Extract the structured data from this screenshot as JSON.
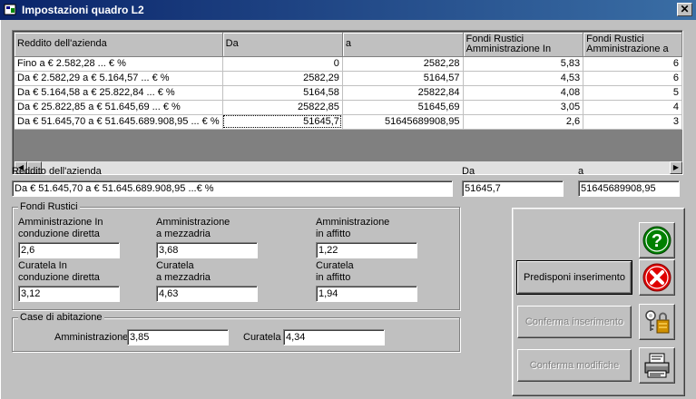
{
  "window": {
    "title": "Impostazioni quadro L2",
    "close_glyph": "✕"
  },
  "grid": {
    "columns": [
      "Reddito dell'azienda",
      "Da",
      "a",
      "Fondi Rustici Amministrazione In",
      "Fondi Rustici Amministrazione a"
    ],
    "rows": [
      [
        "Fino a € 2.582,28 ... € %",
        "0",
        "2582,28",
        "5,83",
        "6"
      ],
      [
        "Da € 2.582,29  a € 5.164,57 ... € %",
        "2582,29",
        "5164,57",
        "4,53",
        "6"
      ],
      [
        "Da € 5.164,58  a € 25.822,84 ... € %",
        "5164,58",
        "25822,84",
        "4,08",
        "5"
      ],
      [
        "Da € 25.822,85  a € 51.645,69 ... € %",
        "25822,85",
        "51645,69",
        "3,05",
        "4"
      ],
      [
        "Da € 51.645,70  a € 51.645.689.908,95 ... € %",
        "51645,7",
        "51645689908,95",
        "2,6",
        "3"
      ]
    ]
  },
  "detail": {
    "reddito_label": "Reddito dell'azienda",
    "reddito_value": "Da € 51.645,70  a € 51.645.689.908,95 ...€ %",
    "da_label": "Da",
    "da_value": "51645,7",
    "a_label": "a",
    "a_value": "51645689908,95"
  },
  "fondi_rustici": {
    "legend": "Fondi Rustici",
    "amm_in_label1": "Amministrazione In",
    "amm_in_label2": "conduzione diretta",
    "amm_in_value": "2,6",
    "amm_mezz_label1": "Amministrazione",
    "amm_mezz_label2": "a mezzadria",
    "amm_mezz_value": "3,68",
    "amm_aff_label1": "Amministrazione",
    "amm_aff_label2": "in affitto",
    "amm_aff_value": "1,22",
    "cur_in_label1": "Curatela In",
    "cur_in_label2": "conduzione diretta",
    "cur_in_value": "3,12",
    "cur_mezz_label1": "Curatela",
    "cur_mezz_label2": "a mezzadria",
    "cur_mezz_value": "4,63",
    "cur_aff_label1": "Curatela",
    "cur_aff_label2": "in affitto",
    "cur_aff_value": "1,94"
  },
  "case_abitazione": {
    "legend": "Case di abitazione",
    "amm_label": "Amministrazione",
    "amm_value": "3,85",
    "cur_label": "Curatela",
    "cur_value": "4,34"
  },
  "buttons": {
    "predisponi": "Predisponi inserimento",
    "conferma_inserimento": "Conferma inserimento",
    "conferma_modifiche": "Conferma modifiche"
  },
  "icons": {
    "help": "help-icon",
    "cancel": "cancel-icon",
    "keys": "keys-icon",
    "printer": "printer-icon"
  },
  "colors": {
    "titlebar_start": "#0a246a",
    "titlebar_end": "#3a6ea5",
    "help_green": "#008000",
    "cancel_red": "#e00000"
  }
}
